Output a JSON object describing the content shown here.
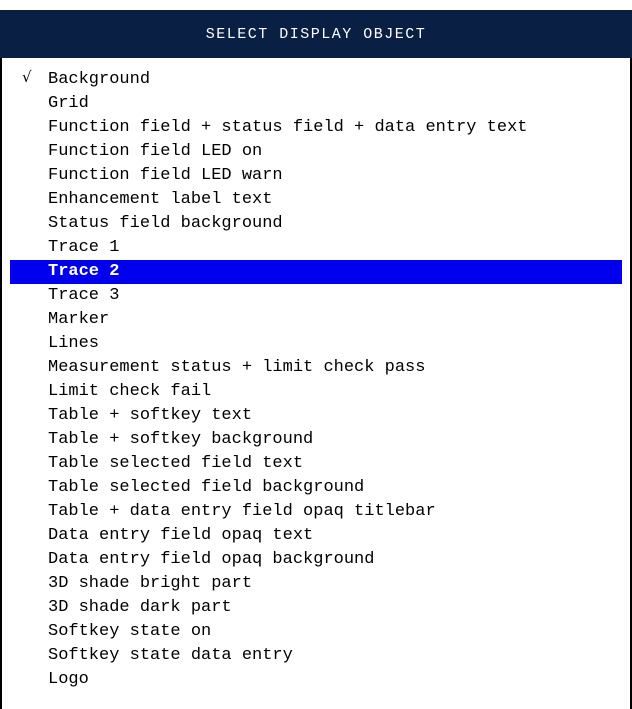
{
  "dialog": {
    "title": "SELECT DISPLAY OBJECT",
    "checked_index": 0,
    "selected_index": 8,
    "checkmark": "√",
    "items": [
      "Background",
      "Grid",
      "Function field + status field + data entry text",
      "Function field LED on",
      "Function field LED warn",
      "Enhancement label text",
      "Status field background",
      "Trace 1",
      "Trace 2",
      "Trace 3",
      "Marker",
      "Lines",
      "Measurement status + limit check pass",
      "Limit check fail",
      "Table + softkey text",
      "Table + softkey background",
      "Table selected field text",
      "Table selected field background",
      "Table + data entry field opaq titlebar",
      "Data entry field opaq text",
      "Data entry field opaq background",
      "3D shade bright part",
      "3D shade dark part",
      "Softkey state on",
      "Softkey state data entry",
      "Logo"
    ]
  },
  "colors": {
    "titlebar": "#0a1f44",
    "selection": "#0000ee"
  }
}
